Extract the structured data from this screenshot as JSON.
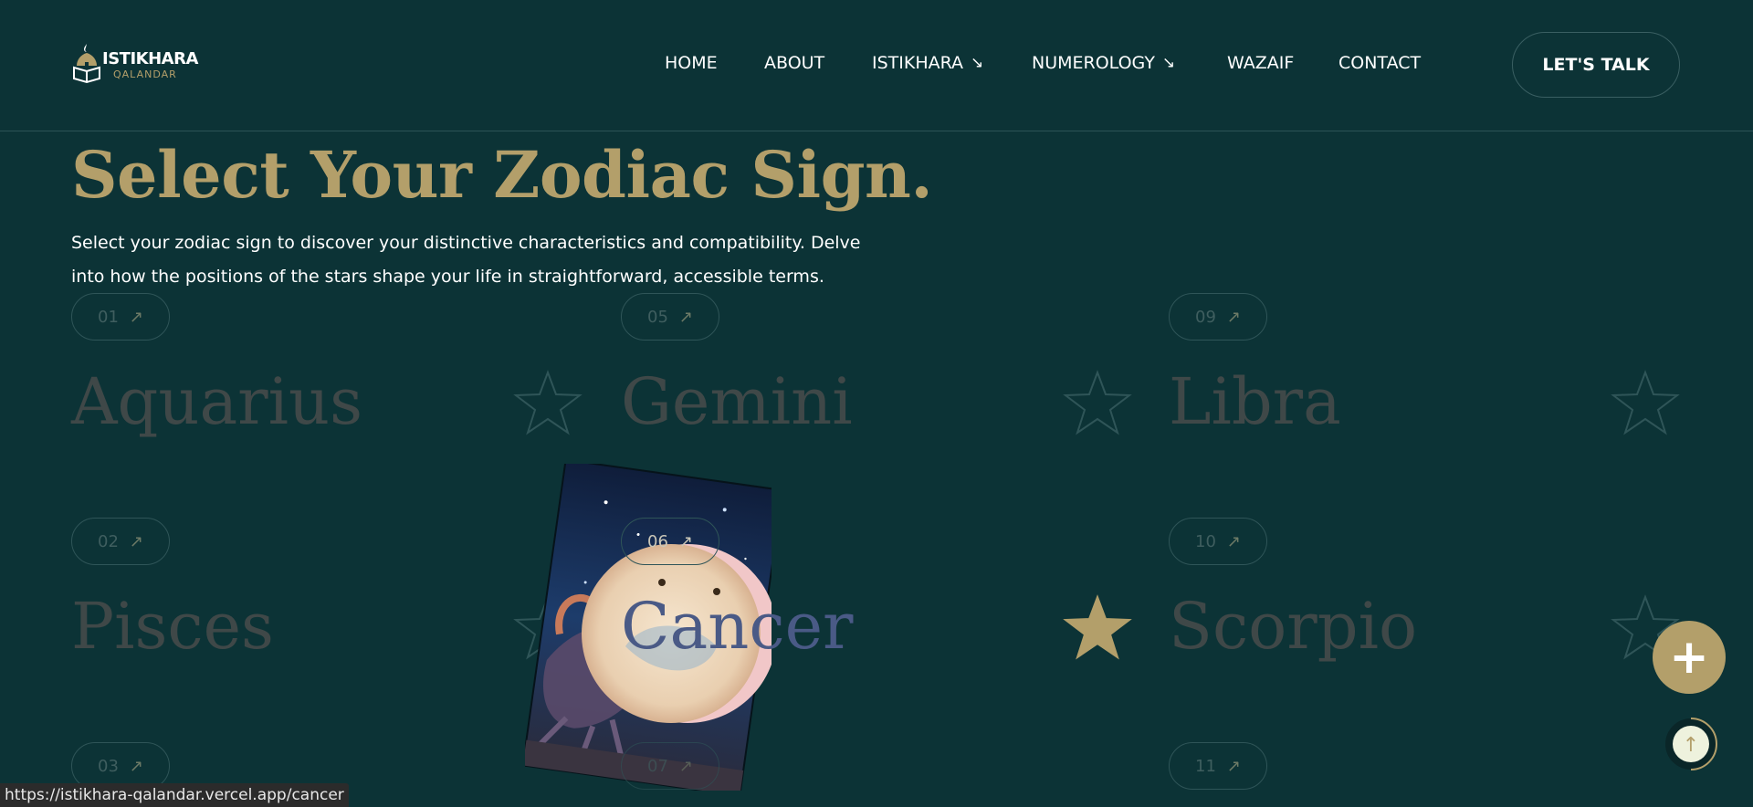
{
  "brand": {
    "name_top": "ISTIKHARA",
    "name_bottom": "QALANDAR",
    "icon": "mosque-book-logo-icon"
  },
  "nav": {
    "items": [
      {
        "label": "HOME",
        "has_arrow": false
      },
      {
        "label": "ABOUT",
        "has_arrow": false
      },
      {
        "label": "ISTIKHARA",
        "has_arrow": true,
        "arrow": "↘"
      },
      {
        "label": "NUMEROLOGY",
        "has_arrow": true,
        "arrow": "↘"
      },
      {
        "label": "WAZAIF",
        "has_arrow": false
      },
      {
        "label": "CONTACT",
        "has_arrow": false
      }
    ],
    "cta": "LET'S TALK"
  },
  "hero": {
    "title": "Select Your Zodiac Sign.",
    "description": "Select your zodiac sign to discover your distinctive characteristics and compatibility. Delve into how the positions of the stars shape your life in straightforward, accessible terms."
  },
  "signs": [
    {
      "number": "01",
      "name": "Aquarius",
      "active": false
    },
    {
      "number": "05",
      "name": "Gemini",
      "active": false
    },
    {
      "number": "09",
      "name": "Libra",
      "active": false
    },
    {
      "number": "02",
      "name": "Pisces",
      "active": false
    },
    {
      "number": "06",
      "name": "Cancer",
      "active": true
    },
    {
      "number": "10",
      "name": "Scorpio",
      "active": false
    },
    {
      "number": "03",
      "name": "",
      "active": false
    },
    {
      "number": "07",
      "name": "",
      "active": false
    },
    {
      "number": "11",
      "name": "",
      "active": false
    }
  ],
  "pill_arrow": "↗",
  "fab": {
    "symbol": "+"
  },
  "scroll_top": {
    "symbol": "↑"
  },
  "status_url": "https://istikhara-qalandar.vercel.app/cancer",
  "colors": {
    "background": "#0c3336",
    "gold": "#b39f6a",
    "muted_text": "#3f4848",
    "active_text": "#4a5a86"
  }
}
